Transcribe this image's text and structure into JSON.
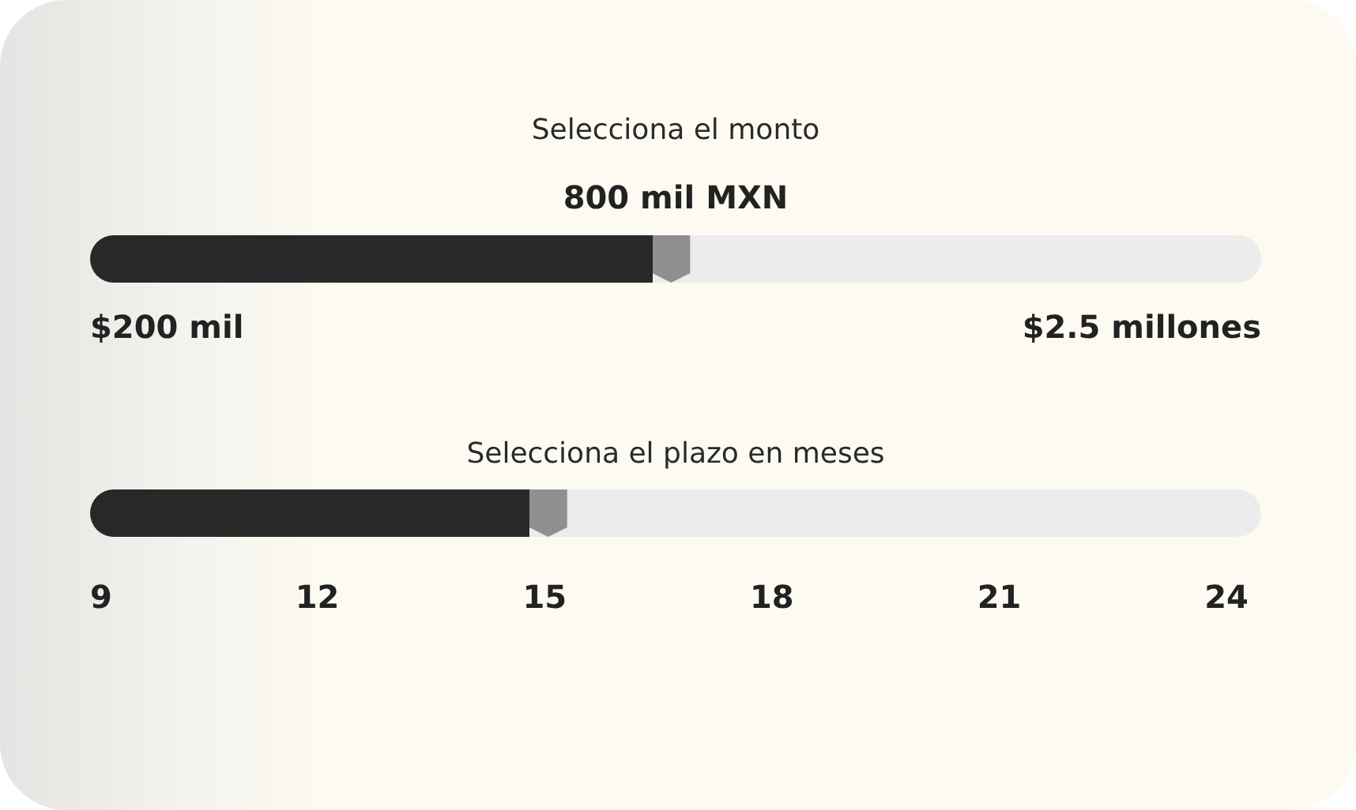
{
  "amount": {
    "title": "Selecciona el monto",
    "value": "800 mil MXN",
    "level": 0.48,
    "min_label": "$200 mil",
    "max_label": "$2.5 millones"
  },
  "term": {
    "title": "Selecciona el plazo en meses",
    "level": 0.375,
    "ticks": [
      "9",
      "12",
      "15",
      "18",
      "21",
      "24"
    ]
  }
}
